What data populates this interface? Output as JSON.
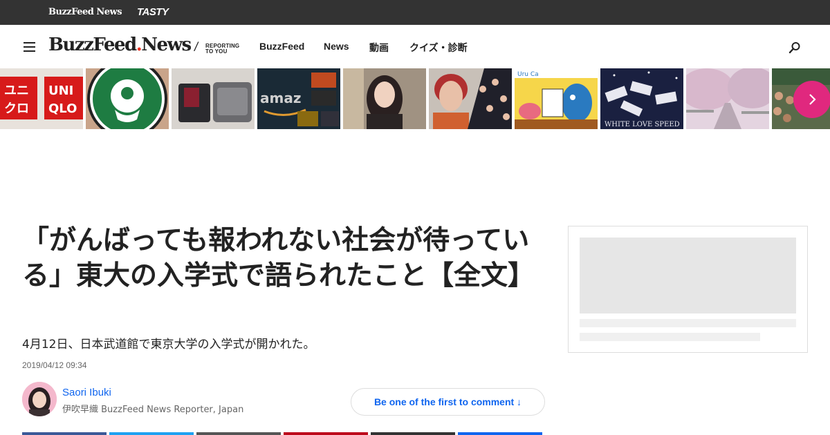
{
  "topbar": {
    "brand": "BuzzFeed News",
    "tasty": "TASTY"
  },
  "header": {
    "logo_main": "BuzzFeed",
    "logo_news": "News",
    "tagline_line1": "REPORTING",
    "tagline_line2": "TO YOU",
    "nav": [
      "BuzzFeed",
      "News",
      "動画",
      "クイズ・診断"
    ]
  },
  "thumbnails": [
    {
      "label": "uniqlo",
      "colors": [
        "#d71a1a",
        "#ffffff"
      ]
    },
    {
      "label": "starbucks",
      "colors": [
        "#1e7c42",
        "#ffffff"
      ]
    },
    {
      "label": "travel-pouch",
      "colors": [
        "#6a6a6a",
        "#8a2030"
      ]
    },
    {
      "label": "amazon-video",
      "colors": [
        "#1a2a36",
        "#c08030"
      ]
    },
    {
      "label": "woman-portrait",
      "colors": [
        "#8a7a6a",
        "#2a2020"
      ]
    },
    {
      "label": "woman-red-hair",
      "colors": [
        "#b03030",
        "#20202a"
      ]
    },
    {
      "label": "illustration",
      "colors": [
        "#f6d64a",
        "#2a7ac0"
      ]
    },
    {
      "label": "white-love-speed",
      "colors": [
        "#1a2040",
        "#e8e8f0"
      ]
    },
    {
      "label": "cherry-blossoms",
      "colors": [
        "#d8c8d8",
        "#9a8aa0"
      ]
    },
    {
      "label": "crowd",
      "colors": [
        "#3a5a3a",
        "#8a6a4a"
      ]
    }
  ],
  "article": {
    "headline": "「がんばっても報われない社会が待っている」東大の入学式で語られたこと【全文】",
    "dek": "4月12日、日本武道館で東京大学の入学式が開かれた。",
    "date": "2019/04/12 09:34",
    "author_name": "Saori Ibuki",
    "author_title": "伊吹早織 BuzzFeed News Reporter, Japan",
    "comment_label": "Be one of the first to comment ↓"
  },
  "share_colors": [
    "#3b5998",
    "#1da1f2",
    "#555555",
    "#bd081c",
    "#333333",
    "#0f65ef"
  ],
  "colors": {
    "topbar": "#333333",
    "accent": "#e0287e",
    "link": "#0f65ef"
  }
}
